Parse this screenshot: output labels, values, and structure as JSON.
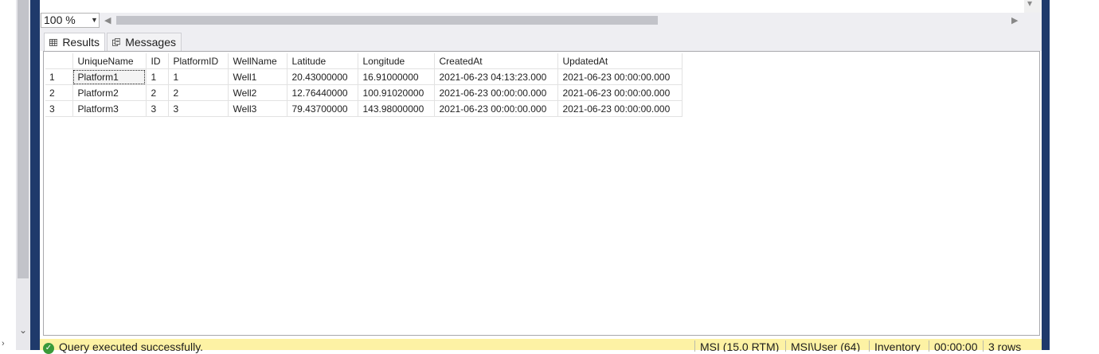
{
  "zoom": {
    "value": "100 %"
  },
  "tabs": {
    "results": "Results",
    "messages": "Messages"
  },
  "grid": {
    "columns": [
      "",
      "UniqueName",
      "ID",
      "PlatformID",
      "WellName",
      "Latitude",
      "Longitude",
      "CreatedAt",
      "UpdatedAt"
    ],
    "rows": [
      [
        "1",
        "Platform1",
        "1",
        "1",
        "Well1",
        "20.43000000",
        "16.91000000",
        "2021-06-23 04:13:23.000",
        "2021-06-23 00:00:00.000"
      ],
      [
        "2",
        "Platform2",
        "2",
        "2",
        "Well2",
        "12.76440000",
        "100.91020000",
        "2021-06-23 00:00:00.000",
        "2021-06-23 00:00:00.000"
      ],
      [
        "3",
        "Platform3",
        "3",
        "3",
        "Well3",
        "79.43700000",
        "143.98000000",
        "2021-06-23 00:00:00.000",
        "2021-06-23 00:00:00.000"
      ]
    ]
  },
  "status": {
    "message": "Query executed successfully.",
    "server": "MSI (15.0 RTM)",
    "user": "MSI\\User (64)",
    "database": "Inventory",
    "elapsed": "00:00:00",
    "rows": "3 rows"
  },
  "colors": {
    "frame": "#1f3a6b",
    "status_bg": "#fdf2a4",
    "success": "#3a9a3a"
  }
}
